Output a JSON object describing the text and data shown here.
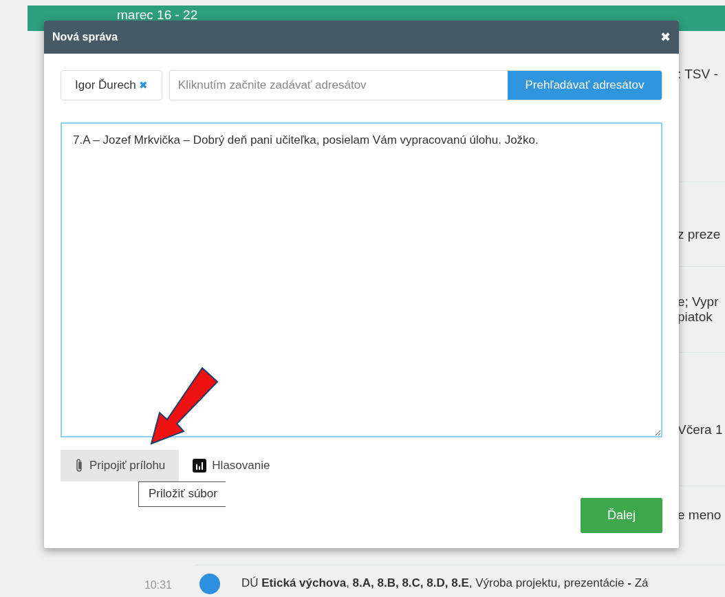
{
  "header": {
    "week": "marec 16 - 22"
  },
  "background_rows": [
    {
      "text": ": TSV -",
      "kind": "single"
    },
    {
      "text": "z preze",
      "kind": "single"
    },
    {
      "text": "e; Vypr",
      "kind": "single",
      "line_2": "piatok"
    },
    {
      "text": "Včera 1",
      "kind": "single"
    },
    {
      "text": "e meno",
      "kind": "single"
    }
  ],
  "last_row": {
    "time": "10:31",
    "text": "DÚ **Etická výchova**, **8.A, 8.B, 8.C, 8.D, 8.E**, Výroba projektu, prezentácie **-** Zá"
  },
  "dialog": {
    "title": "Nová správa",
    "close": "✖",
    "recipients": [
      {
        "name": "Igor Ďurech",
        "remove": "✖"
      }
    ],
    "recipient_input": {
      "placeholder": "Kliknutím začnite zadávať adresátov"
    },
    "browse_button": "Prehľadávať adresátov",
    "message": {
      "value": "7.A – Jozef Mrkvička – Dobrý deň pani učiteľka, posielam Vám vypracovanú úlohu. Jožko."
    },
    "tools": [
      {
        "label": "Pripojiť prílohu",
        "kind": "attach",
        "hovered": true
      },
      {
        "label": "Hlasovanie",
        "kind": "poll",
        "hovered": false
      }
    ],
    "tooltip": "Priložiť súbor",
    "next_button": "Ďalej"
  }
}
